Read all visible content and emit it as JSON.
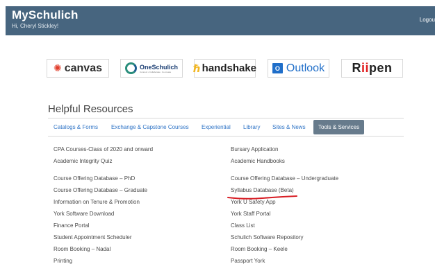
{
  "header": {
    "brand": "MySchulich",
    "greeting": "Hi, Cheryl Stickley!",
    "logout": "Logou"
  },
  "logos": {
    "canvas": "canvas",
    "oneschulich": "OneSchulich",
    "oneschulich_tagline": "Connect • Collaborate • Co-create",
    "handshake": "handshake",
    "outlook": "Outlook",
    "riipen": "Riipen"
  },
  "resources": {
    "title": "Helpful Resources",
    "tabs": [
      {
        "label": "Catalogs & Forms"
      },
      {
        "label": "Exchange & Capstone Courses"
      },
      {
        "label": "Experiential"
      },
      {
        "label": "Library"
      },
      {
        "label": "Sites & News"
      },
      {
        "label": "Tools & Services",
        "active": true
      }
    ],
    "left_links": [
      "CPA Courses-Class of 2020 and onward",
      "Academic Integrity Quiz",
      "Course Offering Database – PhD",
      "Course Offering Database – Graduate",
      "Information on Tenure & Promotion",
      "York Software Download",
      "Finance Portal",
      "Student Appointment Scheduler",
      "Room Booking – Nadal",
      "Printing"
    ],
    "right_links": [
      "Bursary Application",
      "Academic Handbooks",
      "Course Offering Database – Undergraduate",
      "Syllabus Database (Beta)",
      "York U Safety App",
      "York Staff Portal",
      "Class List",
      "Schulich Software Repository",
      "Room Booking – Keele",
      "Passport York"
    ]
  },
  "colors": {
    "header_bg": "#47657f",
    "tab_link": "#2f74c6",
    "active_tab_bg": "#677b8c",
    "annotation_red": "#d81f26"
  }
}
